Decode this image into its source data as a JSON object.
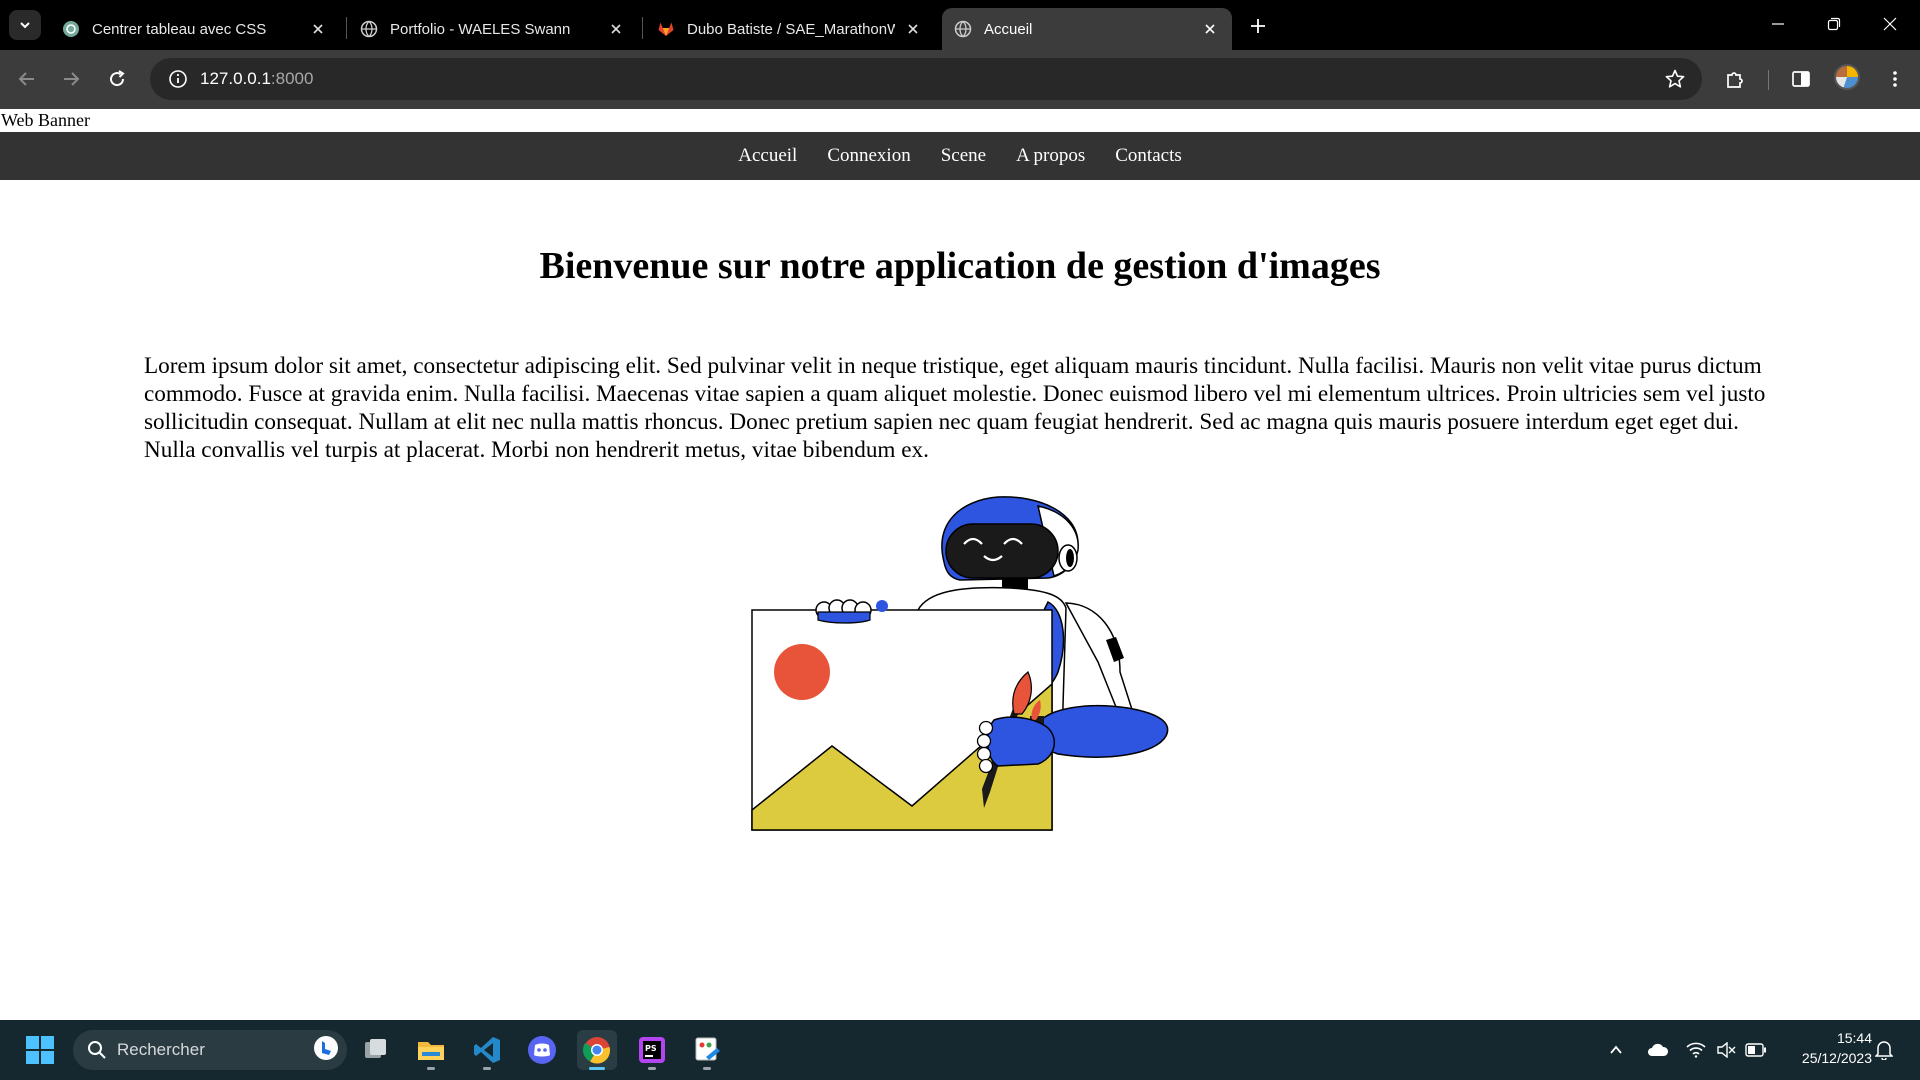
{
  "browser": {
    "tabs": [
      {
        "title": "Centrer tableau avec CSS",
        "icon": "chatgpt-icon"
      },
      {
        "title": "Portfolio - WAELES Swann",
        "icon": "globe-icon"
      },
      {
        "title": "Dubo Batiste / SAE_MarathonW",
        "icon": "gitlab-icon"
      },
      {
        "title": "Accueil",
        "icon": "globe-icon"
      }
    ],
    "address": {
      "host": "127.0.0.1",
      "port": ":8000"
    }
  },
  "page": {
    "banner": "Web Banner",
    "nav": [
      "Accueil",
      "Connexion",
      "Scene",
      "A propos",
      "Contacts"
    ],
    "heading": "Bienvenue sur notre application de gestion d'images",
    "paragraph": "Lorem ipsum dolor sit amet, consectetur adipiscing elit. Sed pulvinar velit in neque tristique, eget aliquam mauris tincidunt. Nulla facilisi. Mauris non velit vitae purus dictum commodo. Fusce at gravida enim. Nulla facilisi. Maecenas vitae sapien a quam aliquet molestie. Donec euismod libero vel mi elementum ultrices. Proin ultricies sem vel justo sollicitudin consequat. Nullam at elit nec nulla mattis rhoncus. Donec pretium sapien nec quam feugiat hendrerit. Sed ac magna quis mauris posuere interdum eget eget dui. Nulla convallis vel turpis at placerat. Morbi non hendrerit metus, vitae bibendum ex."
  },
  "taskbar": {
    "search_placeholder": "Rechercher",
    "apps": [
      "task-view-icon",
      "file-explorer-icon",
      "vscode-icon",
      "discord-icon",
      "chrome-icon",
      "phpstorm-icon",
      "paint-icon"
    ],
    "time": "15:44",
    "date": "25/12/2023"
  },
  "colors": {
    "robot_blue": "#2e55e0",
    "sun_red": "#e8543a",
    "mountain_yellow": "#dccb3f",
    "nav_bg": "#333333"
  }
}
